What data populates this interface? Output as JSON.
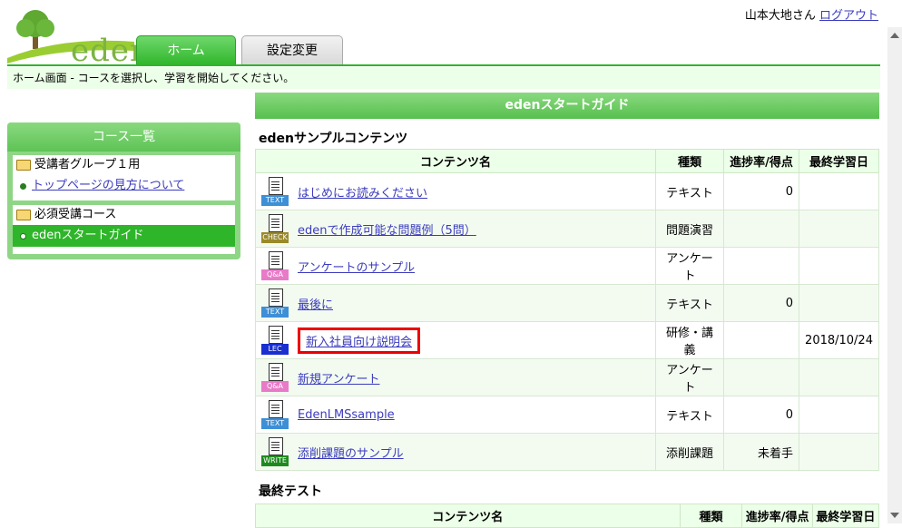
{
  "logo": {
    "text": "eden"
  },
  "user": {
    "name": "山本大地さん",
    "logout": "ログアウト"
  },
  "tabs": [
    {
      "label": "ホーム"
    },
    {
      "label": "設定変更"
    }
  ],
  "breadcrumb": "ホーム画面 - コースを選択し、学習を開始してください。",
  "sidebar": {
    "title": "コース一覧",
    "groups": [
      {
        "label": "受講者グループ１用",
        "item": "トップページの見方について"
      },
      {
        "label": "必須受講コース",
        "item": "edenスタートガイド"
      }
    ]
  },
  "guide_title": "edenスタートガイド",
  "sections": [
    {
      "title": "edenサンプルコンテンツ",
      "headers": [
        "コンテンツ名",
        "種類",
        "進捗率/得点",
        "最終学習日"
      ],
      "rows": [
        {
          "name": "はじめにお読みください",
          "icon": "TEXT",
          "type": "テキスト",
          "progress": "0",
          "date": ""
        },
        {
          "name": "edenで作成可能な問題例（5問）",
          "icon": "CHECK",
          "type": "問題演習",
          "progress": "",
          "date": ""
        },
        {
          "name": "アンケートのサンプル",
          "icon": "Q&A",
          "type": "アンケート",
          "progress": "",
          "date": ""
        },
        {
          "name": "最後に",
          "icon": "TEXT",
          "type": "テキスト",
          "progress": "0",
          "date": ""
        },
        {
          "name": "新入社員向け説明会",
          "icon": "LEC",
          "type": "研修・講義",
          "progress": "",
          "date": "2018/10/24"
        },
        {
          "name": "新規アンケート",
          "icon": "Q&A",
          "type": "アンケート",
          "progress": "",
          "date": ""
        },
        {
          "name": "EdenLMSsample",
          "icon": "TEXT",
          "type": "テキスト",
          "progress": "0",
          "date": ""
        },
        {
          "name": "添削課題のサンプル",
          "icon": "WRITE",
          "type": "添削課題",
          "progress": "未着手",
          "date": ""
        }
      ]
    },
    {
      "title": "最終テスト",
      "headers": [
        "コンテンツ名",
        "種類",
        "進捗率/得点",
        "最終学習日"
      ]
    }
  ],
  "colors": {
    "accent": "#2fb52a",
    "highlight": "#e00000",
    "link": "#3b3bbd"
  }
}
